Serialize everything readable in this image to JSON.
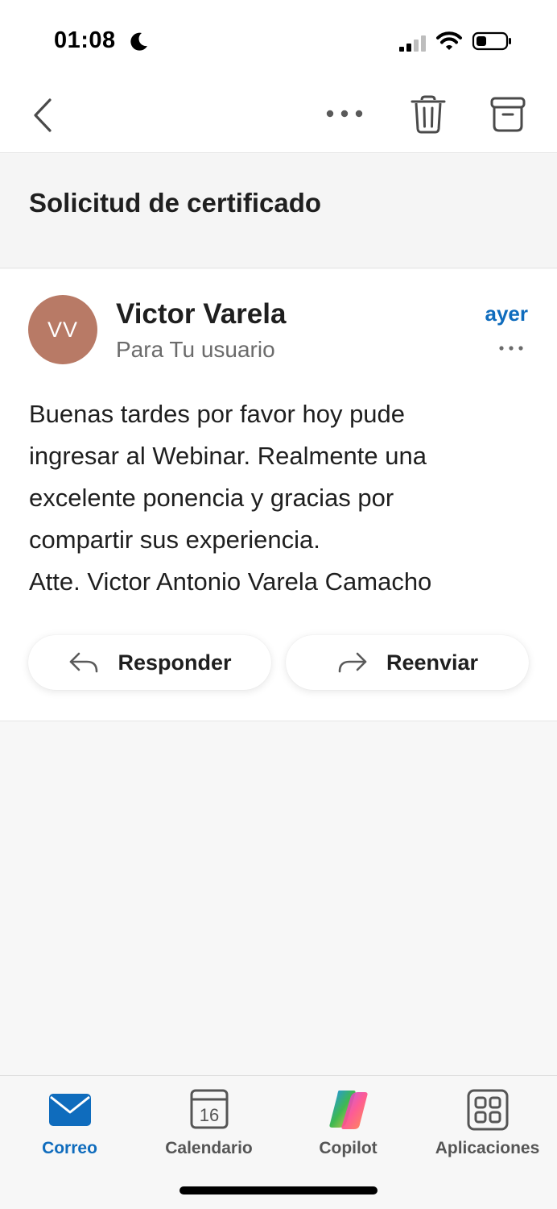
{
  "status_bar": {
    "time": "01:08"
  },
  "toolbar": {
    "back_icon": "chevron-left-icon",
    "more_icon": "more-horizontal-icon",
    "delete_icon": "trash-icon",
    "archive_icon": "archive-icon"
  },
  "subject": "Solicitud de certificado",
  "message": {
    "avatar_initials": "VV",
    "avatar_color": "#b87a66",
    "sender": "Victor Varela",
    "recipient": "Para Tu usuario",
    "date": "ayer",
    "body_lines": [
      "Buenas tardes por favor hoy pude",
      "ingresar al Webinar. Realmente una",
      "excelente ponencia y gracias por",
      "compartir sus experiencia.",
      "Atte. Victor Antonio Varela Camacho"
    ],
    "reply_label": "Responder",
    "forward_label": "Reenviar"
  },
  "tabs": [
    {
      "label": "Correo",
      "icon": "mail-icon",
      "active": true
    },
    {
      "label": "Calendario",
      "icon": "calendar-icon",
      "day": "16"
    },
    {
      "label": "Copilot",
      "icon": "copilot-icon"
    },
    {
      "label": "Aplicaciones",
      "icon": "apps-grid-icon"
    }
  ],
  "colors": {
    "accent": "#0f6cbd",
    "background": "#f7f7f7"
  }
}
